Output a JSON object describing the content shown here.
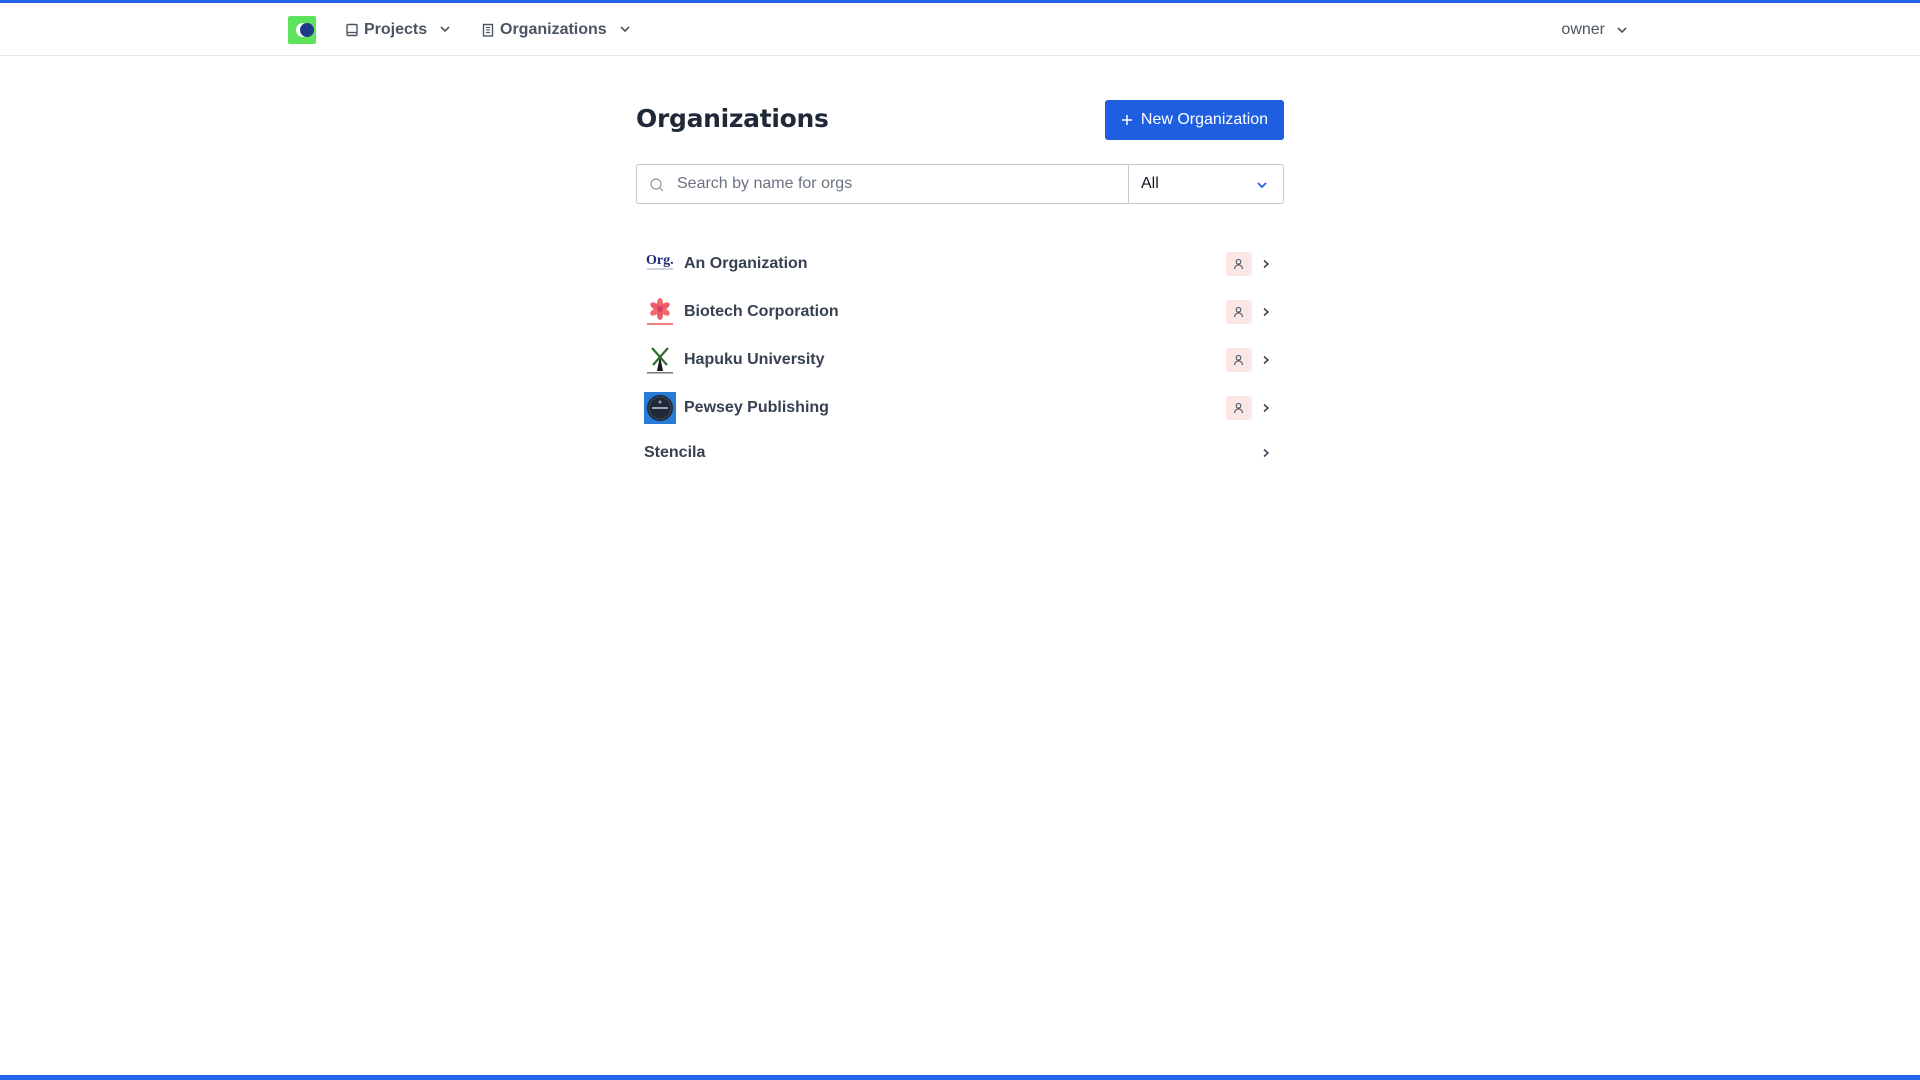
{
  "navbar": {
    "projects_label": "Projects",
    "organizations_label": "Organizations",
    "user_label": "owner"
  },
  "page": {
    "title": "Organizations",
    "new_button_label": "New Organization"
  },
  "search": {
    "placeholder": "Search by name for orgs",
    "value": ""
  },
  "filter": {
    "selected": "All"
  },
  "organizations": [
    {
      "name": "An Organization",
      "logo": "org-text-logo",
      "role_icon": "user-icon"
    },
    {
      "name": "Biotech Corporation",
      "logo": "flower-logo",
      "role_icon": "user-icon"
    },
    {
      "name": "Hapuku University",
      "logo": "windmill-logo",
      "role_icon": "user-icon"
    },
    {
      "name": "Pewsey Publishing",
      "logo": "circle-badge-logo",
      "role_icon": "user-icon"
    },
    {
      "name": "Stencila",
      "logo": "",
      "role_icon": ""
    }
  ],
  "colors": {
    "accent": "#2563eb",
    "button": "#1d5fe0",
    "logo_green": "#5ee35e",
    "badge_bg": "#fbe6e6"
  },
  "logo_text": {
    "org": "Org."
  }
}
